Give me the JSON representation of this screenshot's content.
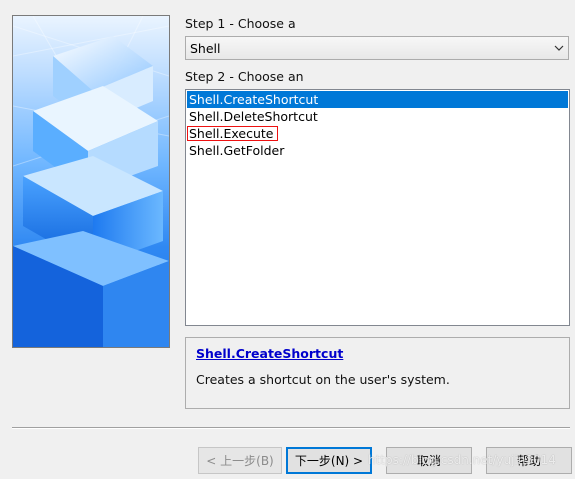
{
  "step1": {
    "label": "Step 1 - Choose a",
    "selected_value": "Shell"
  },
  "step2": {
    "label": "Step 2 - Choose an",
    "items": [
      {
        "label": "Shell.CreateShortcut",
        "selected": true
      },
      {
        "label": "Shell.DeleteShortcut",
        "selected": false
      },
      {
        "label": "Shell.Execute",
        "selected": false,
        "highlighted": true
      },
      {
        "label": "Shell.GetFolder",
        "selected": false
      }
    ]
  },
  "description": {
    "title": "Shell.CreateShortcut",
    "text": "Creates a shortcut on the user's system."
  },
  "buttons": {
    "back": "< 上一步(B)",
    "next": "下一步(N) >",
    "cancel": "取消",
    "help": "帮助"
  },
  "watermark": "https://blog.csdn.net/yujin3014",
  "icons": {
    "combo_arrow": "chevron-down-icon"
  },
  "colors": {
    "selection": "#0078d7",
    "highlight_box": "#e11111",
    "link": "#0000cc"
  }
}
